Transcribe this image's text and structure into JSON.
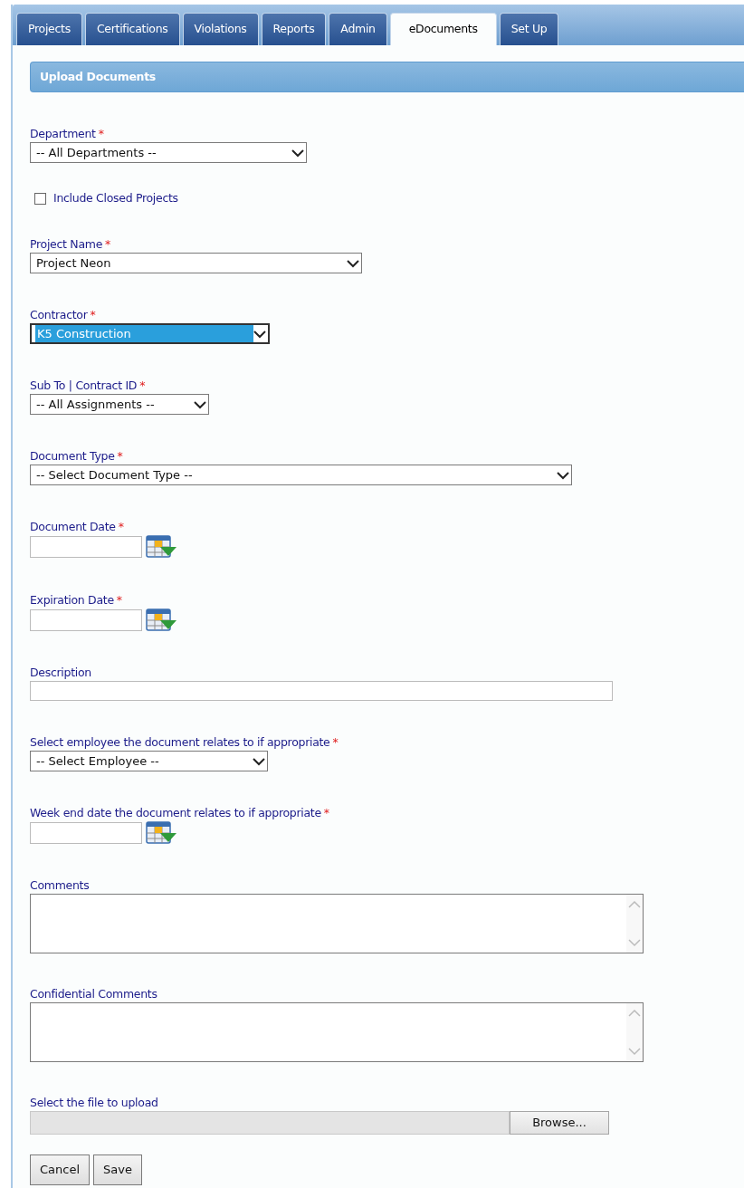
{
  "tabs": [
    {
      "label": "Projects",
      "selected": false
    },
    {
      "label": "Certifications",
      "selected": false
    },
    {
      "label": "Violations",
      "selected": false
    },
    {
      "label": "Reports",
      "selected": false
    },
    {
      "label": "Admin",
      "selected": false
    },
    {
      "label": "eDocuments",
      "selected": true
    },
    {
      "label": "Set Up",
      "selected": false
    }
  ],
  "section": {
    "title": "Upload Documents"
  },
  "fields": [
    {
      "kind": "select",
      "label": "Department",
      "required_mark": "*",
      "value": "-- All Departments --",
      "focused": false
    },
    {
      "kind": "checkbox",
      "label": "Include Closed Projects",
      "checked": false
    },
    {
      "kind": "select",
      "label": "Project Name",
      "required_mark": "*",
      "value": "Project Neon",
      "focused": false
    },
    {
      "kind": "select",
      "label": "Contractor",
      "required_mark": "*",
      "value": "K5 Construction",
      "focused": true
    },
    {
      "kind": "select",
      "label": "Sub To | Contract ID",
      "required_mark": "*",
      "value": "-- All Assignments --",
      "focused": false
    },
    {
      "kind": "select",
      "label": "Document Type",
      "required_mark": "*",
      "value": "-- Select Document Type --",
      "focused": false
    },
    {
      "kind": "date",
      "label": "Document Date",
      "required_mark": "*"
    },
    {
      "kind": "date",
      "label": "Expiration Date",
      "required_mark": "*"
    },
    {
      "kind": "text",
      "label": "Description"
    },
    {
      "kind": "select",
      "label": "Select employee the document relates to if appropriate",
      "required_mark": "*",
      "value": "-- Select Employee --",
      "focused": false
    },
    {
      "kind": "date",
      "label": "Week end date the document relates to if appropriate",
      "required_mark": "*"
    },
    {
      "kind": "textarea",
      "label": "Comments"
    },
    {
      "kind": "textarea",
      "label": "Confidential Comments"
    },
    {
      "kind": "file",
      "label": "Select the file to upload",
      "button": "Browse..."
    }
  ],
  "buttons": [
    "Cancel",
    "Save"
  ]
}
